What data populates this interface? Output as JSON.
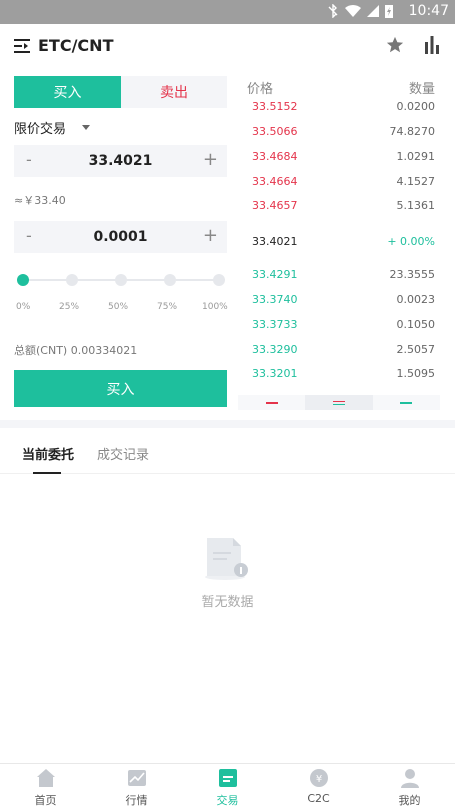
{
  "status_bar": {
    "time": "10:47"
  },
  "header": {
    "pair": "ETC/CNT"
  },
  "trade_tabs": {
    "buy": "买入",
    "sell": "卖出"
  },
  "order_type": "限价交易",
  "price_input": {
    "minus": "-",
    "value": "33.4021",
    "plus": "+"
  },
  "approx": "≈￥33.40",
  "amount_input": {
    "minus": "-",
    "value": "0.0001",
    "plus": "+"
  },
  "slider": {
    "level_percent": 0,
    "ticks": [
      "0%",
      "25%",
      "50%",
      "75%",
      "100%"
    ]
  },
  "total": "总额(CNT) 0.00334021",
  "buy_button": "买入",
  "orderbook": {
    "price_header": "价格",
    "qty_header": "数量",
    "asks": [
      {
        "price": "33.5152",
        "qty": "0.0200"
      },
      {
        "price": "33.5066",
        "qty": "74.8270"
      },
      {
        "price": "33.4684",
        "qty": "1.0291"
      },
      {
        "price": "33.4664",
        "qty": "4.1527"
      },
      {
        "price": "33.4657",
        "qty": "5.1361"
      }
    ],
    "last_price": "33.4021",
    "change": "+ 0.00%",
    "bids": [
      {
        "price": "33.4291",
        "qty": "23.3555"
      },
      {
        "price": "33.3740",
        "qty": "0.0023"
      },
      {
        "price": "33.3733",
        "qty": "0.1050"
      },
      {
        "price": "33.3290",
        "qty": "2.5057"
      },
      {
        "price": "33.3201",
        "qty": "1.5095"
      }
    ]
  },
  "order_tabs": {
    "current": "当前委托",
    "history": "成交记录"
  },
  "empty_text": "暂无数据",
  "bottom_nav": [
    {
      "label": "首页",
      "icon": "home-icon"
    },
    {
      "label": "行情",
      "icon": "market-chart-icon"
    },
    {
      "label": "交易",
      "icon": "trade-icon"
    },
    {
      "label": "C2C",
      "icon": "c2c-coin-icon"
    },
    {
      "label": "我的",
      "icon": "profile-icon"
    }
  ],
  "colors": {
    "accent": "#1ebf9d",
    "sell": "#e4344b"
  }
}
